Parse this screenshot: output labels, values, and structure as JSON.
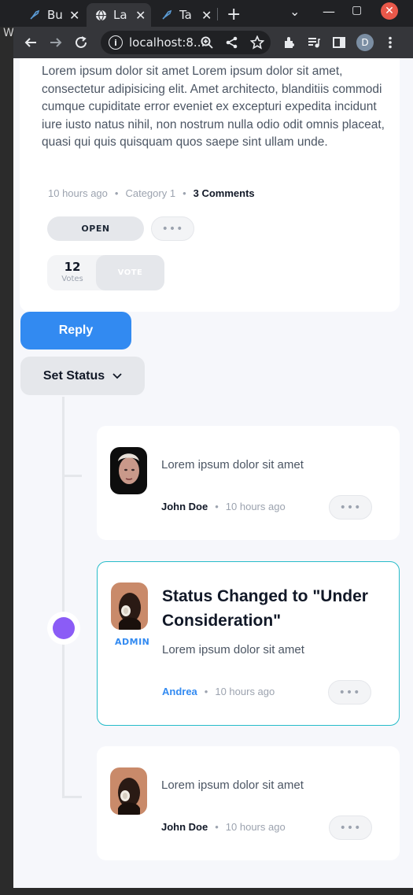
{
  "browser": {
    "tabs": [
      {
        "title": "Bu",
        "close": "✕"
      },
      {
        "title": "La",
        "close": "✕"
      },
      {
        "title": "Ta",
        "close": "✕"
      }
    ],
    "new_tab": "+",
    "url": "localhost:8...",
    "profile_initial": "D",
    "side_letter": "W"
  },
  "idea": {
    "description": "Lorem ipsum dolor sit amet Lorem ipsum dolor sit amet, consectetur adipisicing elit. Amet architecto, blanditiis commodi cumque cupiditate error eveniet ex excepturi expedita incidunt iure iusto natus nihil, non nostrum nulla odio odit omnis placeat, quasi qui quis quisquam quos saepe sint ullam unde.",
    "time": "10 hours ago",
    "category": "Category 1",
    "comments": "3 Comments",
    "status": "OPEN",
    "more": "•••",
    "votes": "12",
    "votes_label": "Votes",
    "vote_button": "VOTE"
  },
  "actions": {
    "reply": "Reply",
    "set_status": "Set Status"
  },
  "comments": [
    {
      "body": "Lorem ipsum dolor sit amet",
      "author": "John Doe",
      "time": "10 hours ago",
      "more": "•••"
    },
    {
      "title": "Status Changed to \"Under Consideration\"",
      "body": "Lorem ipsum dolor sit amet",
      "author": "Andrea",
      "badge": "ADMIN",
      "time": "10 hours ago",
      "more": "•••"
    },
    {
      "body": "Lorem ipsum dolor sit amet",
      "author": "John Doe",
      "time": "10 hours ago",
      "more": "•••"
    }
  ],
  "colors": {
    "primary_blue": "#328af1",
    "timeline_dot": "#8b5cf6",
    "highlight_border": "#26bcc9"
  }
}
